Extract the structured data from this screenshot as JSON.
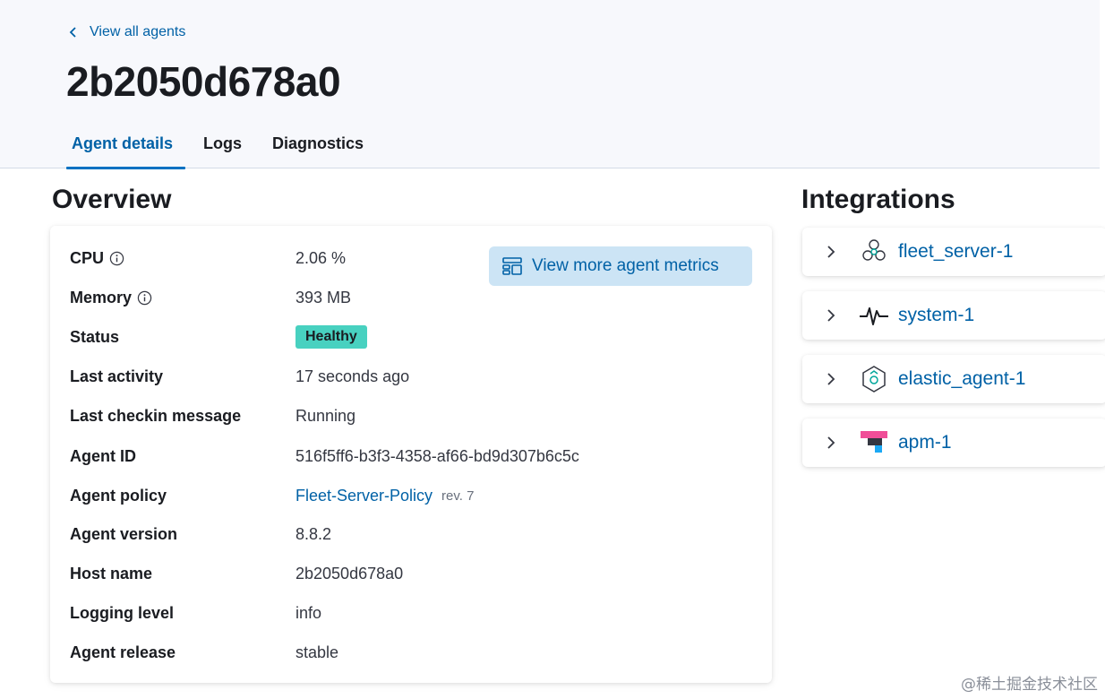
{
  "header": {
    "back_link": "View all agents",
    "title": "2b2050d678a0",
    "tabs": [
      {
        "label": "Agent details",
        "active": true
      },
      {
        "label": "Logs",
        "active": false
      },
      {
        "label": "Diagnostics",
        "active": false
      }
    ]
  },
  "overview": {
    "title": "Overview",
    "metrics_button": "View more agent metrics",
    "rows": {
      "cpu": {
        "label": "CPU",
        "value": "2.06 %"
      },
      "memory": {
        "label": "Memory",
        "value": "393 MB"
      },
      "status": {
        "label": "Status",
        "value": "Healthy"
      },
      "last_activity": {
        "label": "Last activity",
        "value": "17 seconds ago"
      },
      "last_checkin": {
        "label": "Last checkin message",
        "value": "Running"
      },
      "agent_id": {
        "label": "Agent ID",
        "value": "516f5ff6-b3f3-4358-af66-bd9d307b6c5c"
      },
      "agent_policy": {
        "label": "Agent policy",
        "value": "Fleet-Server-Policy",
        "rev": "rev. 7"
      },
      "agent_version": {
        "label": "Agent version",
        "value": "8.8.2"
      },
      "host_name": {
        "label": "Host name",
        "value": "2b2050d678a0"
      },
      "logging_level": {
        "label": "Logging level",
        "value": "info"
      },
      "agent_release": {
        "label": "Agent release",
        "value": "stable"
      }
    }
  },
  "integrations": {
    "title": "Integrations",
    "items": [
      {
        "name": "fleet_server-1",
        "icon": "fleet-server-icon"
      },
      {
        "name": "system-1",
        "icon": "system-pulse-icon"
      },
      {
        "name": "elastic_agent-1",
        "icon": "elastic-agent-icon"
      },
      {
        "name": "apm-1",
        "icon": "apm-icon"
      }
    ]
  },
  "colors": {
    "accent": "#0061a6",
    "healthy_badge": "#48d1c0",
    "header_bg": "#f7f8fc"
  },
  "watermark": "@稀土掘金技术社区"
}
